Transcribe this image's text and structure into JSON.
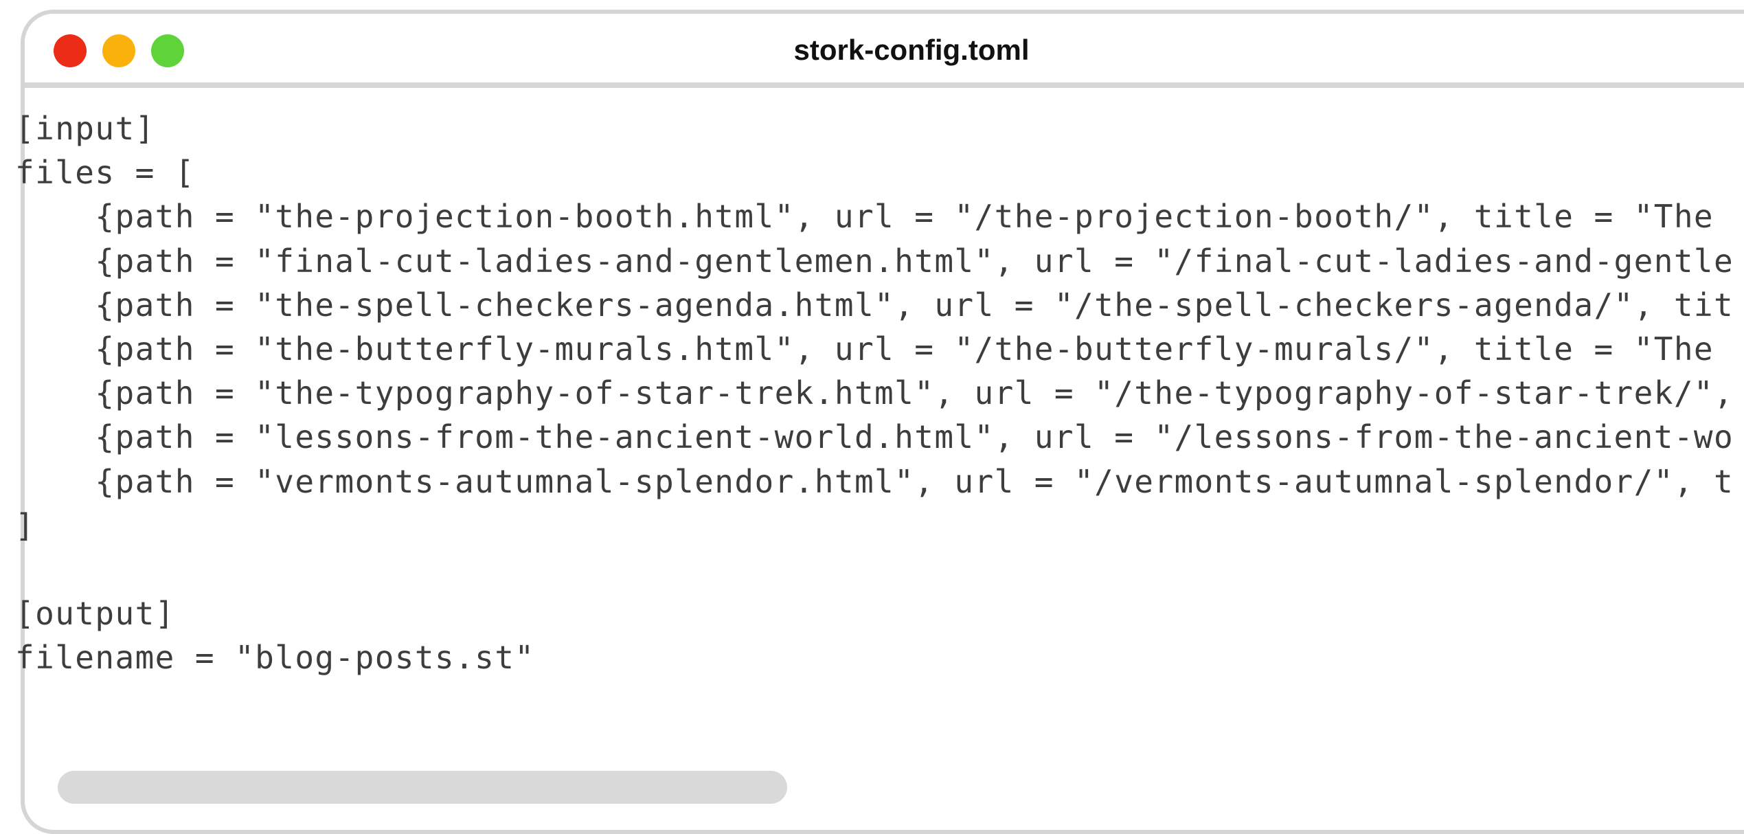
{
  "window": {
    "title": "stork-config.toml",
    "traffic_lights": {
      "close_color": "#ec2c17",
      "minimize_color": "#fbb10b",
      "zoom_color": "#5ed33a"
    }
  },
  "editor": {
    "lines": [
      "[input]",
      "files = [",
      "    {path = \"the-projection-booth.html\", url = \"/the-projection-booth/\", title = \"The",
      "    {path = \"final-cut-ladies-and-gentlemen.html\", url = \"/final-cut-ladies-and-gentle",
      "    {path = \"the-spell-checkers-agenda.html\", url = \"/the-spell-checkers-agenda/\", tit",
      "    {path = \"the-butterfly-murals.html\", url = \"/the-butterfly-murals/\", title = \"The",
      "    {path = \"the-typography-of-star-trek.html\", url = \"/the-typography-of-star-trek/\",",
      "    {path = \"lessons-from-the-ancient-world.html\", url = \"/lessons-from-the-ancient-wo",
      "    {path = \"vermonts-autumnal-splendor.html\", url = \"/vermonts-autumnal-splendor/\", t",
      "]",
      "",
      "[output]",
      "filename = \"blog-posts.st\""
    ]
  },
  "colors": {
    "frame_border": "#d5d5d5",
    "code_text": "#3d3d3d",
    "scrollbar_thumb": "#d9d9d9"
  }
}
